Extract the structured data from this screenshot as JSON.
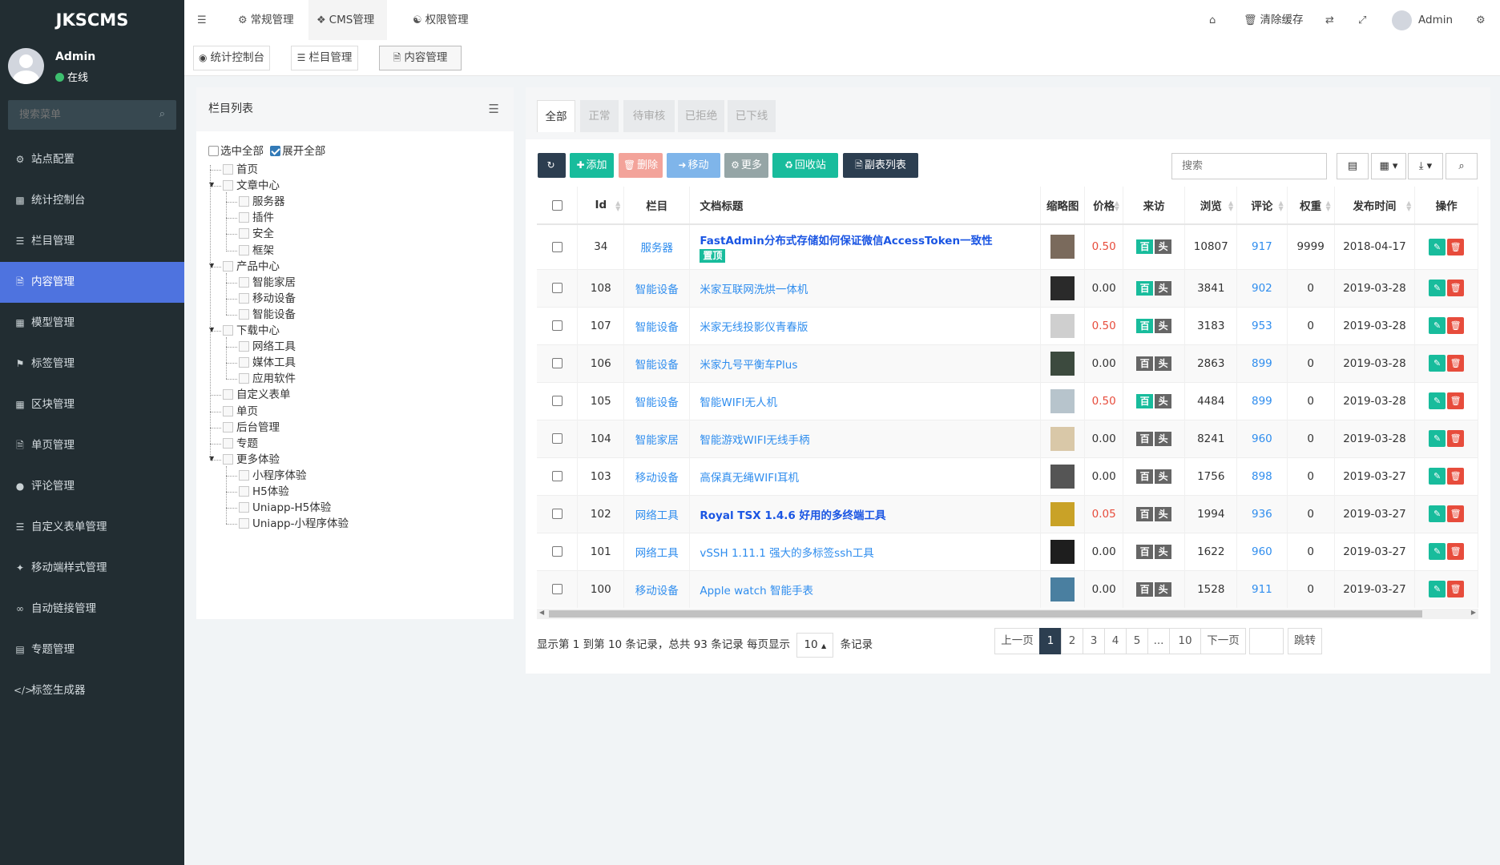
{
  "brand": "JKSCMS",
  "user": {
    "name": "Admin",
    "status": "在线"
  },
  "menu_search_placeholder": "搜索菜单",
  "menu": [
    {
      "label": "站点配置",
      "icon": "gears-icon"
    },
    {
      "label": "统计控制台",
      "icon": "bar-chart-icon"
    },
    {
      "label": "栏目管理",
      "icon": "list-icon"
    },
    {
      "label": "内容管理",
      "icon": "file-icon"
    },
    {
      "label": "模型管理",
      "icon": "grid-icon"
    },
    {
      "label": "标签管理",
      "icon": "tag-icon"
    },
    {
      "label": "区块管理",
      "icon": "th-large-icon"
    },
    {
      "label": "单页管理",
      "icon": "file-icon"
    },
    {
      "label": "评论管理",
      "icon": "comment-icon"
    },
    {
      "label": "自定义表单管理",
      "icon": "list-icon"
    },
    {
      "label": "移动端样式管理",
      "icon": "magic-icon"
    },
    {
      "label": "自动链接管理",
      "icon": "link-icon"
    },
    {
      "label": "专题管理",
      "icon": "newspaper-icon"
    },
    {
      "label": "标签生成器",
      "icon": "code-icon"
    }
  ],
  "active_menu": "内容管理",
  "topnav": {
    "general": "常规管理",
    "cms": "CMS管理",
    "auth": "权限管理",
    "clear_cache": "清除缓存",
    "admin": "Admin"
  },
  "page_tabs": [
    "统计控制台",
    "栏目管理",
    "内容管理"
  ],
  "left_panel": {
    "title": "栏目列表",
    "select_all": "选中全部",
    "expand_all": "展开全部",
    "tree": [
      {
        "label": "首页",
        "level": 0
      },
      {
        "label": "文章中心",
        "level": 0
      },
      {
        "label": "服务器",
        "level": 1
      },
      {
        "label": "插件",
        "level": 1
      },
      {
        "label": "安全",
        "level": 1
      },
      {
        "label": "框架",
        "level": 1
      },
      {
        "label": "产品中心",
        "level": 0
      },
      {
        "label": "智能家居",
        "level": 1
      },
      {
        "label": "移动设备",
        "level": 1
      },
      {
        "label": "智能设备",
        "level": 1
      },
      {
        "label": "下载中心",
        "level": 0
      },
      {
        "label": "网络工具",
        "level": 1
      },
      {
        "label": "媒体工具",
        "level": 1
      },
      {
        "label": "应用软件",
        "level": 1
      },
      {
        "label": "自定义表单",
        "level": 0
      },
      {
        "label": "单页",
        "level": 0
      },
      {
        "label": "后台管理",
        "level": 0
      },
      {
        "label": "专题",
        "level": 0
      },
      {
        "label": "更多体验",
        "level": 0
      },
      {
        "label": "小程序体验",
        "level": 1
      },
      {
        "label": "H5体验",
        "level": 1
      },
      {
        "label": "Uniapp-H5体验",
        "level": 1
      },
      {
        "label": "Uniapp-小程序体验",
        "level": 1
      }
    ]
  },
  "status_tabs": [
    "全部",
    "正常",
    "待审核",
    "已拒绝",
    "已下线"
  ],
  "toolbar": {
    "add": "添加",
    "delete": "删除",
    "move": "移动",
    "more": "更多",
    "recycle": "回收站",
    "sublist": "副表列表",
    "search_placeholder": "搜索"
  },
  "columns": [
    "Id",
    "栏目",
    "文档标题",
    "缩略图",
    "价格",
    "来访",
    "浏览",
    "评论",
    "权重",
    "发布时间",
    "操作"
  ],
  "source_labels": {
    "baidu": "百",
    "toutiao": "头"
  },
  "rows": [
    {
      "id": "34",
      "cat": "服务器",
      "title": "FastAdmin分布式存储如何保证微信AccessToken一致性",
      "flag": "置顶",
      "price": "0.50",
      "baidu": true,
      "views": "10807",
      "comments": "917",
      "weight": "9999",
      "date": "2018-04-17",
      "thumb": "#7a6a5c",
      "bold": true
    },
    {
      "id": "108",
      "cat": "智能设备",
      "title": "米家互联网洗烘一体机",
      "flag": "",
      "price": "0.00",
      "baidu": true,
      "views": "3841",
      "comments": "902",
      "weight": "0",
      "date": "2019-03-28",
      "thumb": "#2a2a2a",
      "bold": false
    },
    {
      "id": "107",
      "cat": "智能设备",
      "title": "米家无线投影仪青春版",
      "flag": "",
      "price": "0.50",
      "baidu": true,
      "views": "3183",
      "comments": "953",
      "weight": "0",
      "date": "2019-03-28",
      "thumb": "#cfcfcf",
      "bold": false
    },
    {
      "id": "106",
      "cat": "智能设备",
      "title": "米家九号平衡车Plus",
      "flag": "",
      "price": "0.00",
      "baidu": false,
      "views": "2863",
      "comments": "899",
      "weight": "0",
      "date": "2019-03-28",
      "thumb": "#3c4a3e",
      "bold": false
    },
    {
      "id": "105",
      "cat": "智能设备",
      "title": "智能WIFI无人机",
      "flag": "",
      "price": "0.50",
      "baidu": true,
      "views": "4484",
      "comments": "899",
      "weight": "0",
      "date": "2019-03-28",
      "thumb": "#b7c4cc",
      "bold": false
    },
    {
      "id": "104",
      "cat": "智能家居",
      "title": "智能游戏WIFI无线手柄",
      "flag": "",
      "price": "0.00",
      "baidu": false,
      "views": "8241",
      "comments": "960",
      "weight": "0",
      "date": "2019-03-28",
      "thumb": "#d9c8a8",
      "bold": false
    },
    {
      "id": "103",
      "cat": "移动设备",
      "title": "高保真无绳WIFI耳机",
      "flag": "",
      "price": "0.00",
      "baidu": false,
      "views": "1756",
      "comments": "898",
      "weight": "0",
      "date": "2019-03-27",
      "thumb": "#555555",
      "bold": false
    },
    {
      "id": "102",
      "cat": "网络工具",
      "title": "Royal TSX 1.4.6 好用的多终端工具",
      "flag": "",
      "price": "0.05",
      "baidu": false,
      "views": "1994",
      "comments": "936",
      "weight": "0",
      "date": "2019-03-27",
      "thumb": "#c9a227",
      "bold": true
    },
    {
      "id": "101",
      "cat": "网络工具",
      "title": "vSSH 1.11.1 强大的多标签ssh工具",
      "flag": "",
      "price": "0.00",
      "baidu": false,
      "views": "1622",
      "comments": "960",
      "weight": "0",
      "date": "2019-03-27",
      "thumb": "#1e1e1e",
      "bold": false
    },
    {
      "id": "100",
      "cat": "移动设备",
      "title": "Apple watch 智能手表",
      "flag": "",
      "price": "0.00",
      "baidu": false,
      "views": "1528",
      "comments": "911",
      "weight": "0",
      "date": "2019-03-27",
      "thumb": "#4a7fa0",
      "bold": false
    }
  ],
  "pagination": {
    "info_prefix": "显示第 1 到第 10 条记录，总共 93 条记录 每页显示",
    "page_size": "10",
    "info_suffix": "条记录",
    "prev": "上一页",
    "pages": [
      "1",
      "2",
      "3",
      "4",
      "5",
      "...",
      "10"
    ],
    "next": "下一页",
    "jump": "跳转"
  }
}
